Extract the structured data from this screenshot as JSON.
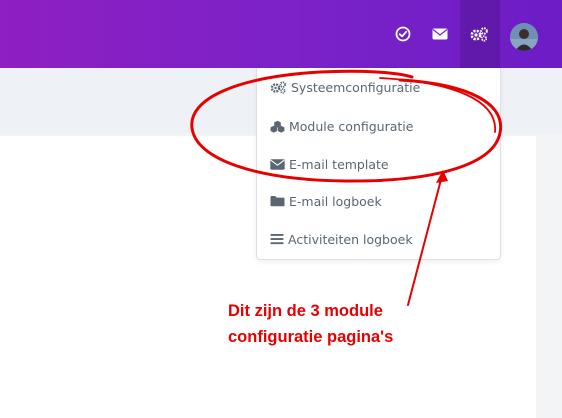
{
  "topbar": {
    "icons": [
      "check-circle-icon",
      "envelope-icon",
      "cogs-icon",
      "avatar"
    ],
    "color": "#7a22c8"
  },
  "dropdown": {
    "items": [
      {
        "label": "Systeemconfiguratie",
        "icon": "cogs-icon"
      },
      {
        "label": "Module configuratie",
        "icon": "cubes-icon"
      },
      {
        "label": "E-mail template",
        "icon": "envelope-icon"
      },
      {
        "label": "E-mail logboek",
        "icon": "folder-icon"
      },
      {
        "label": "Activiteiten logboek",
        "icon": "list-icon"
      }
    ]
  },
  "annotation": {
    "line1": "Dit zijn de 3 module",
    "line2": "configuratie pagina's",
    "color": "#e60000"
  }
}
